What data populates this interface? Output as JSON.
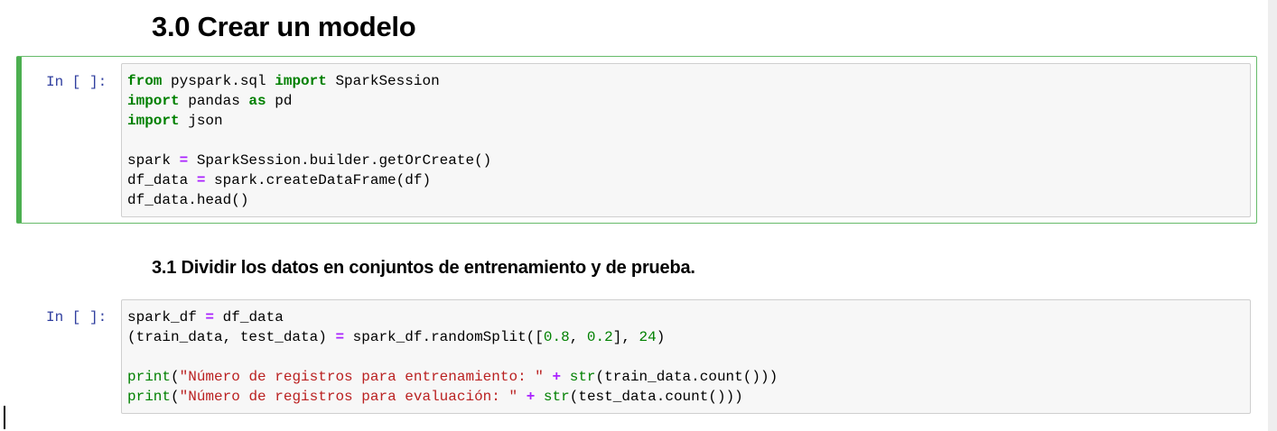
{
  "headings": {
    "section_title": "3.0 Crear un modelo",
    "subsection_title": "3.1 Dividir los datos en conjuntos de entrenamiento y de prueba."
  },
  "cells": [
    {
      "prompt": "In [ ]:",
      "selected": true,
      "lines": [
        "from pyspark.sql import SparkSession",
        "import pandas as pd",
        "import json",
        "",
        "spark = SparkSession.builder.getOrCreate()",
        "df_data = spark.createDataFrame(df)",
        "df_data.head()"
      ]
    },
    {
      "prompt": "In [ ]:",
      "selected": false,
      "lines": [
        "spark_df = df_data",
        "(train_data, test_data) = spark_df.randomSplit([0.8, 0.2], 24)",
        "",
        "print(\"Número de registros para entrenamiento: \" + str(train_data.count()))",
        "print(\"Número de registros para evaluación: \" + str(test_data.count()))"
      ]
    }
  ],
  "colors": {
    "keyword": "#008000",
    "operator": "#aa22ff",
    "string": "#ba2121",
    "prompt": "#303f9f",
    "selected_border": "#4caf50"
  }
}
